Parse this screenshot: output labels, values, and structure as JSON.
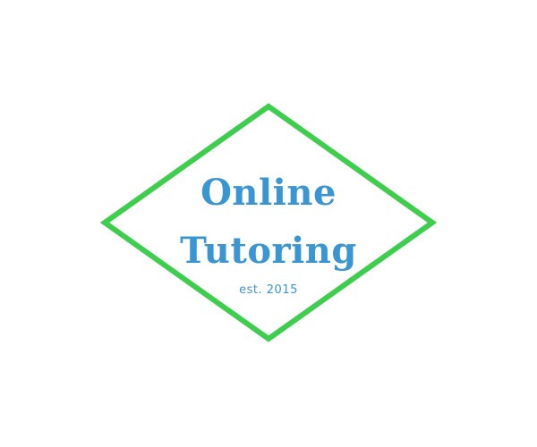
{
  "logo": {
    "title_line_1": "Online",
    "title_line_2": "Tutoring",
    "tagline": "est. 2015"
  },
  "colors": {
    "frame": "#3cce4c",
    "text": "#3a95d3",
    "background": "#ffffff"
  },
  "icons": {
    "frame_shape": "diamond-frame"
  }
}
